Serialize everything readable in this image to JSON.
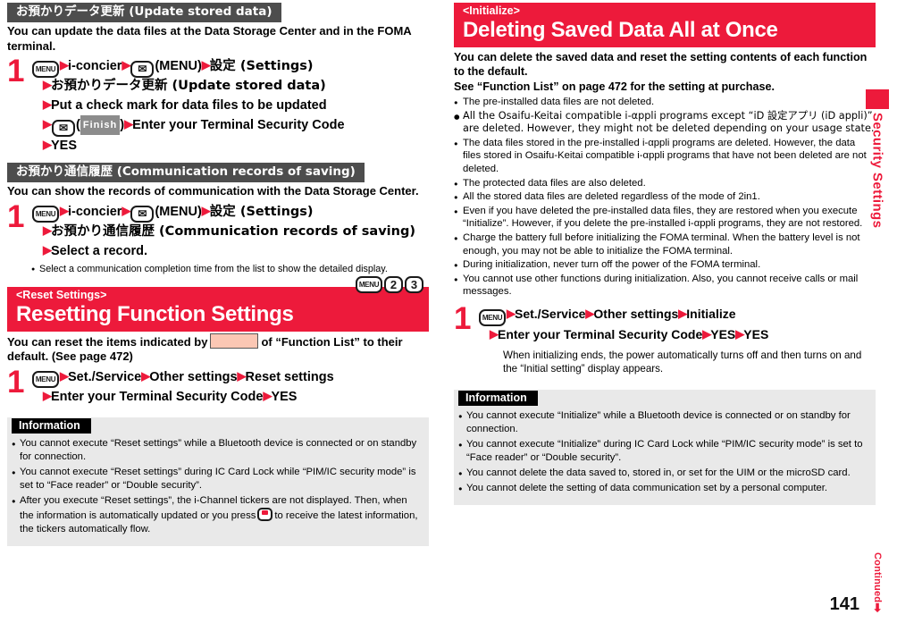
{
  "page": {
    "number": "141",
    "continued_label": "Continued",
    "side_tab_label": "Security Settings",
    "accent_red": "#ed1a3b",
    "header_gray": "#4d4d4d",
    "info_bg": "#e9e9e9"
  },
  "left": {
    "section1": {
      "bar_title": "お預かりデータ更新 (Update stored data)",
      "lead": "You can update the data files at the Data Storage Center and in the FOMA terminal.",
      "step_number": "1",
      "keys": {
        "menu": "MENU",
        "mail": "✉"
      },
      "line1_a": "i-concier",
      "line1_b": "(MENU)",
      "line1_c": "設定 (Settings)",
      "line2": "お預かりデータ更新 (Update stored data)",
      "line3": "Put a check mark for data files to be updated",
      "line4_open": "(",
      "line4_softkey": "Finish",
      "line4_close": ")",
      "line4_b": "Enter your Terminal Security Code",
      "line5": "YES"
    },
    "section2": {
      "bar_title": "お預かり通信履歴 (Communication records of saving)",
      "lead": "You can show the records of communication with the Data Storage Center.",
      "step_number": "1",
      "line1_a": "i-concier",
      "line1_b": "(MENU)",
      "line1_c": "設定 (Settings)",
      "line2": "お預かり通信履歴 (Communication records of saving)",
      "line3": "Select a record.",
      "note": "Select a communication completion time from the list to show the detailed display."
    },
    "section3": {
      "sub_title": "<Reset Settings>",
      "title": "Resetting Function Settings",
      "keys": [
        "MENU",
        "2",
        "3"
      ],
      "lead_a": "You can reset the items indicated by",
      "lead_b": "of “Function List” to their default. (See page 472)",
      "step_number": "1",
      "line1_a": "Set./Service",
      "line1_b": "Other settings",
      "line1_c": "Reset settings",
      "line2_a": "Enter your Terminal Security Code",
      "line2_b": "YES"
    },
    "information": {
      "title": "Information",
      "items": [
        "You cannot execute “Reset settings” while a Bluetooth device is connected or on standby for connection.",
        "You cannot execute “Reset settings” during IC Card Lock while “PIM/IC security mode” is set to “Face reader” or “Double security”.",
        "After you execute “Reset settings”, the i-Channel tickers are not displayed. Then, when the information is automatically updated or you press"
      ],
      "item3_tail": "to receive the latest information, the tickers automatically flow."
    }
  },
  "right": {
    "header": {
      "sub_title": "<Initialize>",
      "title": "Deleting Saved Data All at Once"
    },
    "lead_line1": "You can delete the saved data and reset the setting contents of each function to the default.",
    "lead_line2": "See “Function List” on page 472 for the setting at purchase.",
    "bullets": [
      "The pre-installed data files are not deleted.",
      "All the Osaifu-Keitai compatible i-αppli programs except “iD 設定アプリ (iD appli)” are deleted. However, they might not be deleted depending on your usage state.",
      "The data files stored in the pre-installed i-αppli programs are deleted. However, the data files stored in Osaifu-Keitai compatible i-αppli programs that have not been deleted are not deleted.",
      "The protected data files are also deleted.",
      "All the stored data files are deleted regardless of the mode of 2in1.",
      "Even if you have deleted the pre-installed data files, they are restored when you execute “Initialize”. However, if you delete the pre-installed i-αppli programs, they are not restored.",
      "Charge the battery full before initializing the FOMA terminal. When the battery level is not enough, you may not be able to initialize the FOMA terminal.",
      "During initialization, never turn off the power of the FOMA terminal.",
      "You cannot use other functions during initialization. Also, you cannot receive calls or mail messages."
    ],
    "step": {
      "number": "1",
      "key_menu": "MENU",
      "line1_a": "Set./Service",
      "line1_b": "Other settings",
      "line1_c": "Initialize",
      "line2_a": "Enter your Terminal Security Code",
      "line2_b": "YES",
      "line2_c": "YES",
      "post": "When initializing ends, the power automatically turns off and then turns on and the “Initial setting” display appears."
    },
    "information": {
      "title": "Information",
      "items": [
        "You cannot execute “Initialize” while a Bluetooth device is connected or on standby for connection.",
        "You cannot execute “Initialize” during IC Card Lock while “PIM/IC security mode” is set to “Face reader” or “Double security”.",
        "You cannot delete the data saved to, stored in, or set for the UIM or the microSD card.",
        "You cannot delete the setting of data communication set by a personal computer."
      ]
    }
  }
}
